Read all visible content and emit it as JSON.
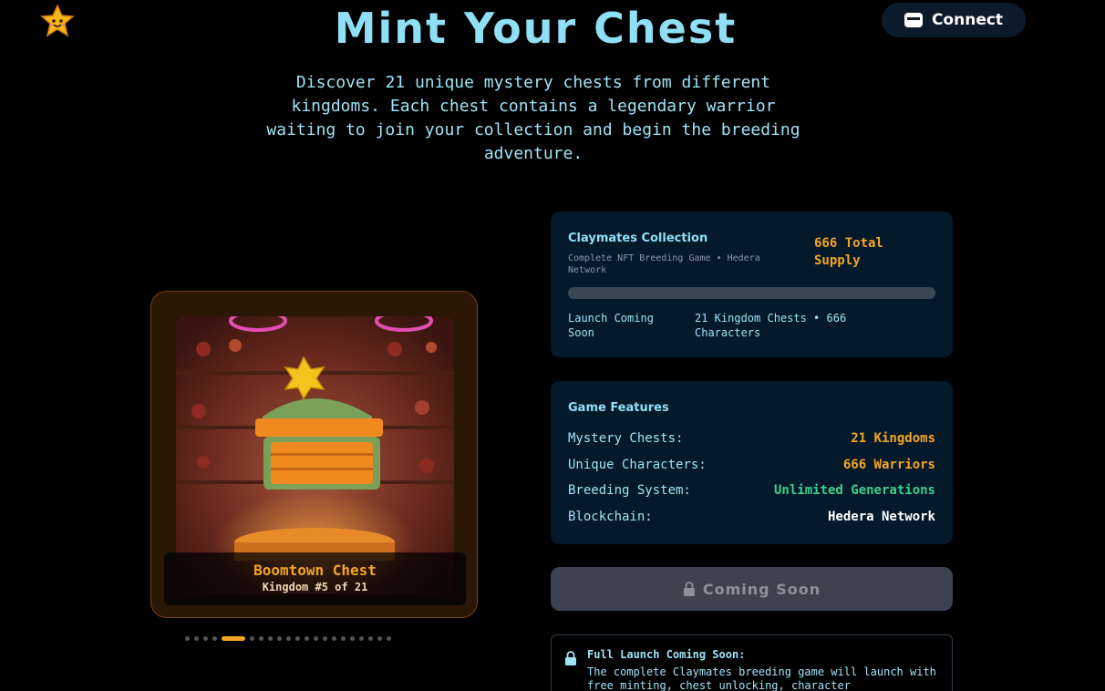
{
  "header": {
    "logo_icon": "smiling-star-icon",
    "title": "Mint Your Chest",
    "connect_label": "Connect",
    "connect_icon": "wallet-icon"
  },
  "intro": "Discover 21 unique mystery chests from different kingdoms. Each chest contains a legendary warrior waiting to join your collection and begin the breeding adventure.",
  "chest": {
    "name": "Boomtown Chest",
    "kingdom": "Kingdom #5 of 21",
    "carousel": {
      "total": 21,
      "active_index": 4
    }
  },
  "collection": {
    "title": "Claymates Collection",
    "subtitle": "Complete NFT Breeding Game • Hedera Network",
    "supply": "666 Total Supply",
    "progress": 0,
    "status": "Launch Coming Soon",
    "summary": "21 Kingdom Chests • 666 Characters"
  },
  "features": {
    "title": "Game Features",
    "rows": [
      {
        "label": "Mystery Chests:",
        "value": "21 Kingdoms",
        "color": "#f5a524"
      },
      {
        "label": "Unique Characters:",
        "value": "666 Warriors",
        "color": "#f5a524"
      },
      {
        "label": "Breeding System:",
        "value": "Unlimited Generations",
        "color": "#3ecf8e"
      },
      {
        "label": "Blockchain:",
        "value": "Hedera Network",
        "color": "#ffffff"
      }
    ]
  },
  "mint_button": {
    "label": "Coming Soon",
    "icon": "lock-icon"
  },
  "notice": {
    "icon": "lock-icon",
    "title": "Full Launch Coming Soon:",
    "text": "The complete Claymates breeding game will launch with free minting, chest unlocking, character"
  },
  "colors": {
    "accent": "#f5a524",
    "heading": "#8fe0f7",
    "panel": "#04192a",
    "green": "#3ecf8e"
  }
}
